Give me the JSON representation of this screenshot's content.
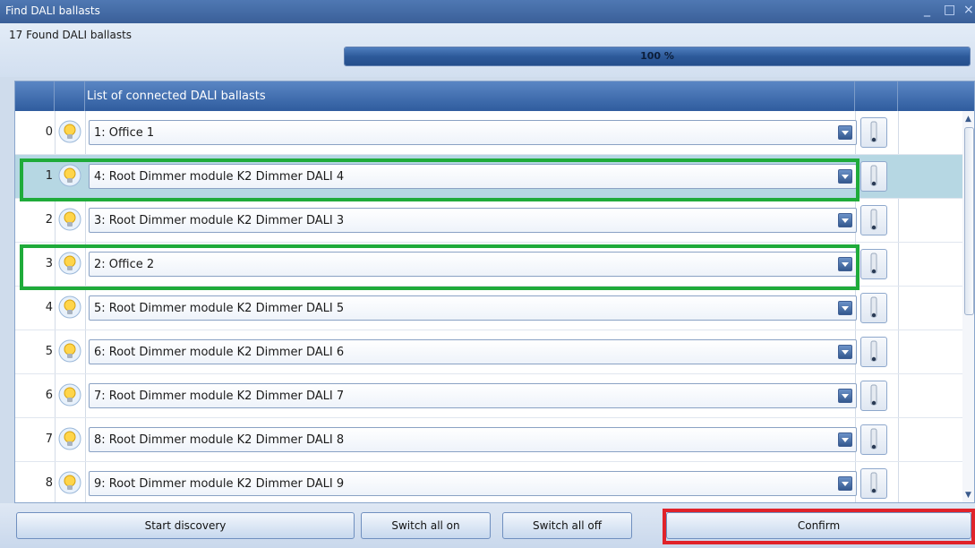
{
  "window": {
    "title": "Find DALI ballasts",
    "minimize_glyph": "_",
    "maximize_glyph": "□",
    "close_glyph": "×"
  },
  "status": {
    "found_label": "17 Found DALI ballasts",
    "progress_text": "100 %",
    "progress_value": 1.0
  },
  "grid": {
    "header": "List of connected DALI ballasts"
  },
  "rows": [
    {
      "index": "0",
      "ballast": "1: Office 1",
      "selected": false,
      "highlighted": false
    },
    {
      "index": "1",
      "ballast": "4: Root Dimmer module K2 Dimmer DALI 4",
      "selected": true,
      "highlighted": true
    },
    {
      "index": "2",
      "ballast": "3: Root Dimmer module K2 Dimmer DALI 3",
      "selected": false,
      "highlighted": false
    },
    {
      "index": "3",
      "ballast": "2: Office 2",
      "selected": false,
      "highlighted": true
    },
    {
      "index": "4",
      "ballast": "5: Root Dimmer module K2 Dimmer DALI 5",
      "selected": false,
      "highlighted": false
    },
    {
      "index": "5",
      "ballast": "6: Root Dimmer module K2 Dimmer DALI 6",
      "selected": false,
      "highlighted": false
    },
    {
      "index": "6",
      "ballast": "7: Root Dimmer module K2 Dimmer DALI 7",
      "selected": false,
      "highlighted": false
    },
    {
      "index": "7",
      "ballast": "8: Root Dimmer module K2 Dimmer DALI 8",
      "selected": false,
      "highlighted": false
    },
    {
      "index": "8",
      "ballast": "9: Root Dimmer module K2 Dimmer DALI 9",
      "selected": false,
      "highlighted": false
    }
  ],
  "icons": {
    "bulb": "lightbulb-icon",
    "switch": "toggle-switch-icon",
    "dropdown": "chevron-down-icon"
  },
  "buttons": {
    "start_discovery": "Start discovery",
    "switch_all_on": "Switch all on",
    "switch_all_off": "Switch all off",
    "confirm": "Confirm"
  },
  "colors": {
    "highlight_green": "#1fab3a",
    "highlight_red": "#e0232a",
    "selected_row": "#b6d7e3",
    "header_blue": "#3a5f98"
  }
}
